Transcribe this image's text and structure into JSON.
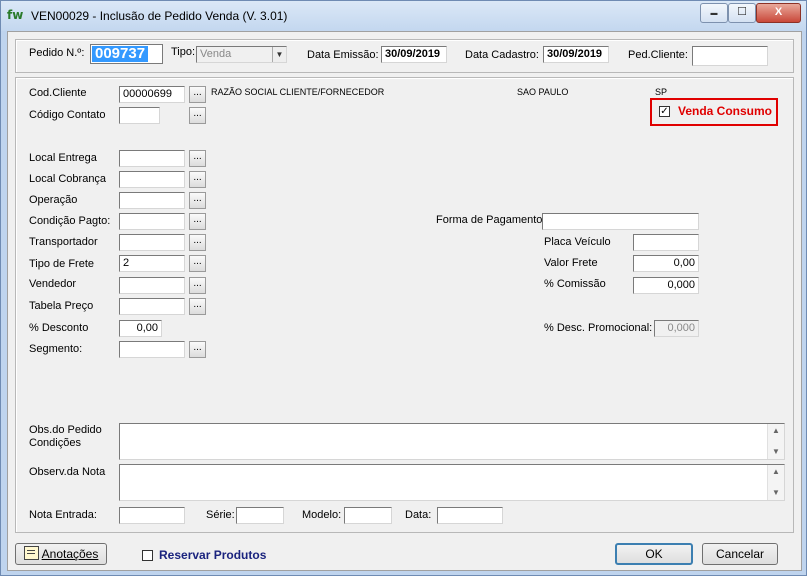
{
  "window": {
    "app_icon": "fw",
    "title": "VEN00029 - Inclusão de Pedido Venda  (V. 3.01)",
    "minimize_glyph": "▬",
    "maximize_glyph": "☐",
    "close_glyph": "X"
  },
  "header": {
    "pedido_label": "Pedido N.º:",
    "pedido_value": "009737",
    "tipo_label": "Tipo:",
    "tipo_value": "Venda",
    "data_emissao_label": "Data Emissão:",
    "data_emissao_value": "30/09/2019",
    "data_cadastro_label": "Data Cadastro:",
    "data_cadastro_value": "30/09/2019",
    "ped_cliente_label": "Ped.Cliente:",
    "ped_cliente_value": ""
  },
  "form": {
    "cod_cliente_label": "Cod.Cliente",
    "cod_cliente_value": "00000699",
    "razao_social": "RAZÃO SOCIAL CLIENTE/FORNECEDOR",
    "cidade": "SAO PAULO",
    "uf": "SP",
    "codigo_contato_label": "Código Contato",
    "venda_consumo_label": "Venda Consumo",
    "venda_consumo_checked": "✓",
    "local_entrega_label": "Local Entrega",
    "local_cobranca_label": "Local Cobrança",
    "operacao_label": "Operação",
    "condicao_pagto_label": "Condição Pagto:",
    "transportador_label": "Transportador",
    "tipo_frete_label": "Tipo de Frete",
    "tipo_frete_value": "2",
    "vendedor_label": "Vendedor",
    "tabela_preco_label": "Tabela  Preço",
    "desconto_label": "% Desconto",
    "desconto_value": "0,00",
    "segmento_label": "Segmento:",
    "forma_pagamento_label": "Forma de Pagamento:",
    "placa_veiculo_label": "Placa Veículo",
    "valor_frete_label": "Valor Frete",
    "valor_frete_value": "0,00",
    "comissao_label": "% Comissão",
    "comissao_value": "0,000",
    "desc_promocional_label": "% Desc. Promocional:",
    "desc_promocional_value": "0,000",
    "obs_pedido_label": "Obs.do Pedido",
    "condicoes_label": "Condições",
    "observ_nota_label": "Observ.da Nota",
    "nota_entrada_label": "Nota Entrada:",
    "serie_label": "Série:",
    "modelo_label": "Modelo:",
    "data_label": "Data:",
    "dots": "..."
  },
  "footer": {
    "anotacoes_label": "Anotações",
    "reservar_label": "Reservar Produtos",
    "ok_label": "OK",
    "cancelar_label": "Cancelar"
  },
  "colors": {
    "highlight_red": "#e00000",
    "selection_blue": "#3399ff",
    "reservar_text": "#1a237e"
  }
}
